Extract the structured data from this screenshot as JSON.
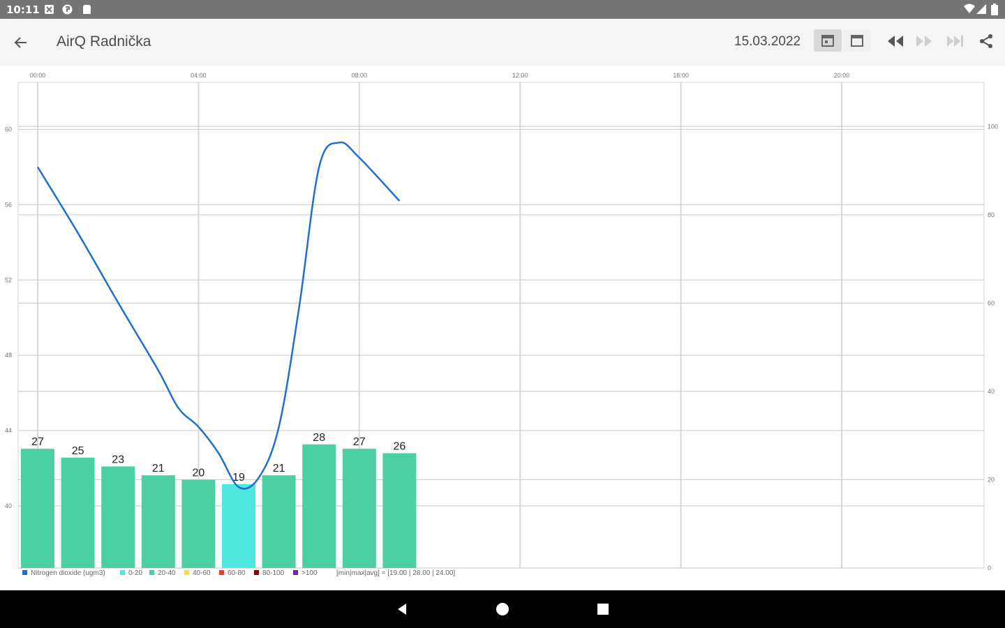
{
  "status": {
    "time": "10:11"
  },
  "header": {
    "title": "AirQ Radnička",
    "date": "15.03.2022"
  },
  "chart_data": {
    "type": "bar+line",
    "x_ticks": [
      "00:00",
      "04:00",
      "08:00",
      "12:00",
      "16:00",
      "20:00"
    ],
    "x_range_hours": [
      0,
      24
    ],
    "left_axis": {
      "ticks": [
        "60",
        "56",
        "52",
        "48",
        "44",
        "40"
      ],
      "range": [
        36.7,
        62.5
      ]
    },
    "right_axis": {
      "ticks": [
        "100",
        "80",
        "60",
        "40",
        "20",
        "0"
      ],
      "range": [
        0,
        110
      ]
    },
    "bars": {
      "hours": [
        0,
        1,
        2,
        3,
        4,
        5,
        6,
        7,
        8,
        9
      ],
      "values": [
        27,
        25,
        23,
        21,
        20,
        19,
        21,
        28,
        27,
        26
      ],
      "colors": [
        "#4dcfa5",
        "#4dcfa5",
        "#4dcfa5",
        "#4dcfa5",
        "#4dcfa5",
        "#4ee8e0",
        "#4dcfa5",
        "#4dcfa5",
        "#4dcfa5",
        "#4dcfa5"
      ]
    },
    "line": {
      "name": "Nitrogen dioxide (ugm3)",
      "color": "#1f6fd1",
      "hours": [
        0,
        1,
        2,
        3,
        3.5,
        4,
        4.5,
        5,
        5.5,
        6,
        6.5,
        7,
        7.5,
        8,
        9
      ],
      "values": [
        58,
        54.5,
        50.8,
        47.2,
        45.2,
        44.2,
        42.8,
        41.0,
        41.5,
        44.2,
        50.5,
        58.0,
        59.3,
        58.5,
        56.2
      ]
    },
    "legend": [
      {
        "label": "Nitrogen dioxide (ugm3)",
        "color": "#1f6fd1"
      },
      {
        "label": "0-20",
        "color": "#4ee8e0"
      },
      {
        "label": "20-40",
        "color": "#4dcfa5"
      },
      {
        "label": "40-60",
        "color": "#f0e040"
      },
      {
        "label": "60-80",
        "color": "#ff3030"
      },
      {
        "label": "80-100",
        "color": "#8b0000"
      },
      {
        "label": ">100",
        "color": "#7a1fa2"
      }
    ],
    "summary": "[min|max|avg] = [19.00 | 28.00 | 24.00]"
  }
}
